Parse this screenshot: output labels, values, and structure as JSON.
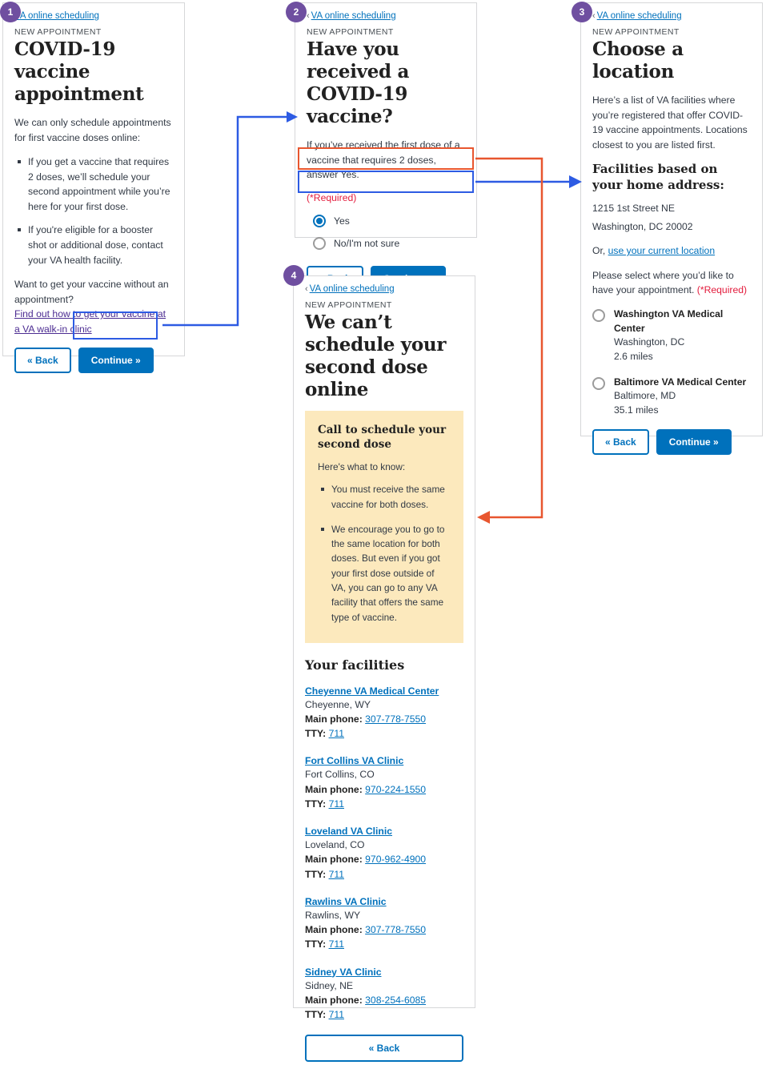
{
  "meta": {
    "colors": {
      "purple_badge": "#6f4fa0",
      "link_blue": "#0071bc",
      "link_purple": "#4c2c92",
      "primary_button": "#0071bc",
      "required_red": "#e31c3d",
      "alert_bg": "#fce9bd",
      "arrow_blue": "#2d5be3",
      "arrow_red": "#e8562f",
      "panel_border": "#d6d7d9"
    }
  },
  "steps": {
    "one": "1",
    "two": "2",
    "three": "3",
    "four": "4"
  },
  "breadcrumb": {
    "chevron": "‹",
    "label": "VA online scheduling"
  },
  "common": {
    "eyebrow": "NEW APPOINTMENT",
    "back_label": "« Back",
    "continue_label": "Continue »",
    "required_label": "(*Required)"
  },
  "panel1": {
    "title": "COVID-19 vaccine appointment",
    "intro": "We can only schedule appointments for first vaccine doses online:",
    "bullets": [
      "If you get a vaccine that requires 2 doses, we’ll schedule your second appointment while you’re here for your first dose.",
      "If you're eligible for a booster shot or additional dose, contact your VA health facility."
    ],
    "walkin_question": "Want to get your vaccine without an appointment?",
    "walkin_link": "Find out how to get your vaccine at a VA walk-in clinic"
  },
  "panel2": {
    "title": "Have you received a COVID-19 vaccine?",
    "description": "If you’ve received the first dose of a vaccine that requires 2 doses, answer Yes.",
    "required": "(*Required)",
    "options": [
      {
        "label": "Yes",
        "selected": true
      },
      {
        "label": "No/I'm not sure",
        "selected": false
      }
    ]
  },
  "panel3": {
    "title": "Choose a location",
    "description": "Here’s a list of VA facilities where you’re registered that offer COVID-19 vaccine appointments. Locations closest to you are listed first.",
    "sub_heading": "Facilities based on your home address:",
    "address_line1": "1215 1st Street NE",
    "address_line2": "Washington, DC 20002",
    "or_prefix": "Or, ",
    "current_location_link": "use your current location",
    "select_prompt": "Please select where you’d like to have your appointment. ",
    "required": "(*Required)",
    "facilities": [
      {
        "name": "Washington VA Medical Center",
        "city": "Washington, DC",
        "distance": "2.6 miles",
        "selected": false
      },
      {
        "name": "Baltimore VA Medical Center",
        "city": "Baltimore, MD",
        "distance": "35.1 miles",
        "selected": false
      }
    ]
  },
  "panel4": {
    "title": "We can’t schedule your second dose online",
    "alert": {
      "heading": "Call to schedule your second dose",
      "intro": "Here's what to know:",
      "bullets": [
        "You must receive the same vaccine for both doses.",
        "We encourage you to go to the same location for both doses. But even if you got your first dose outside of VA, you can go to any VA facility that offers the same type of vaccine."
      ]
    },
    "facilities_heading": "Your facilities",
    "phone_label": "Main phone:",
    "tty_label": "TTY:",
    "facilities": [
      {
        "name": "Cheyenne VA Medical Center",
        "location": "Cheyenne, WY",
        "phone": "307-778-7550",
        "tty": "711"
      },
      {
        "name": "Fort Collins VA Clinic",
        "location": "Fort Collins, CO",
        "phone": "970-224-1550",
        "tty": "711"
      },
      {
        "name": "Loveland VA Clinic",
        "location": "Loveland, CO",
        "phone": "970-962-4900",
        "tty": "711"
      },
      {
        "name": "Rawlins VA Clinic",
        "location": "Rawlins, WY",
        "phone": "307-778-7550",
        "tty": "711"
      },
      {
        "name": "Sidney VA Clinic",
        "location": "Sidney, NE",
        "phone": "308-254-6085",
        "tty": "711"
      }
    ],
    "back_label": "« Back"
  }
}
